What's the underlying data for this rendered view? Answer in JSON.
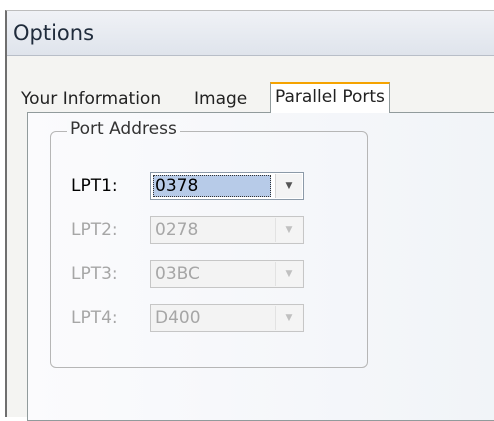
{
  "window": {
    "title": "Options"
  },
  "tabs": [
    {
      "label": "Your Information",
      "active": false
    },
    {
      "label": "Image",
      "active": false
    },
    {
      "label": "Parallel Ports",
      "active": true
    }
  ],
  "port_address": {
    "group_label": "Port Address",
    "ports": [
      {
        "label": "LPT1:",
        "value": "0378",
        "enabled": true
      },
      {
        "label": "LPT2:",
        "value": "0278",
        "enabled": false
      },
      {
        "label": "LPT3:",
        "value": "03BC",
        "enabled": false
      },
      {
        "label": "LPT4:",
        "value": "D400",
        "enabled": false
      }
    ]
  },
  "icons": {
    "dropdown": "chevron-down-icon"
  },
  "colors": {
    "tab_highlight": "#f5a300",
    "selection": "#b7cbe8",
    "disabled_text": "#a6a6a6"
  }
}
